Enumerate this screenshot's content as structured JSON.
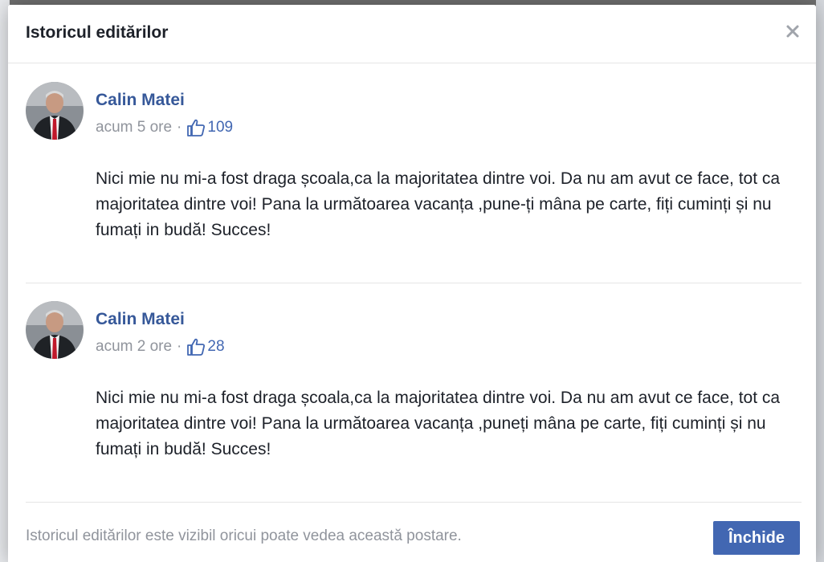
{
  "dialog": {
    "title": "Istoricul editărilor",
    "close_icon": "close-icon",
    "footer_note": "Istoricul editărilor este vizibil oricui poate vedea această postare.",
    "close_button_label": "Închide"
  },
  "entries": [
    {
      "author": "Calin Matei",
      "time": "acum 5 ore",
      "likes": "109",
      "icon": "thumbs-up-icon",
      "text": "Nici mie nu mi-a fost draga școala,ca la majoritatea dintre voi. Da nu am avut ce face, tot ca majoritatea dintre voi! Pana la următoarea vacanța ,pune-ți mâna pe carte, fiți cuminți și nu fumați in budă! Succes!"
    },
    {
      "author": "Calin Matei",
      "time": "acum 2 ore",
      "likes": "28",
      "icon": "thumbs-up-icon",
      "text": "Nici mie nu mi-a fost draga școala,ca la majoritatea dintre voi. Da nu am avut ce face, tot ca majoritatea dintre voi! Pana la următoarea vacanța ,puneți mâna pe carte, fiți cuminți și nu fumați in budă! Succes!"
    }
  ],
  "colors": {
    "link": "#365899",
    "meta": "#90949c",
    "button": "#4267b2",
    "text": "#1d2129"
  }
}
